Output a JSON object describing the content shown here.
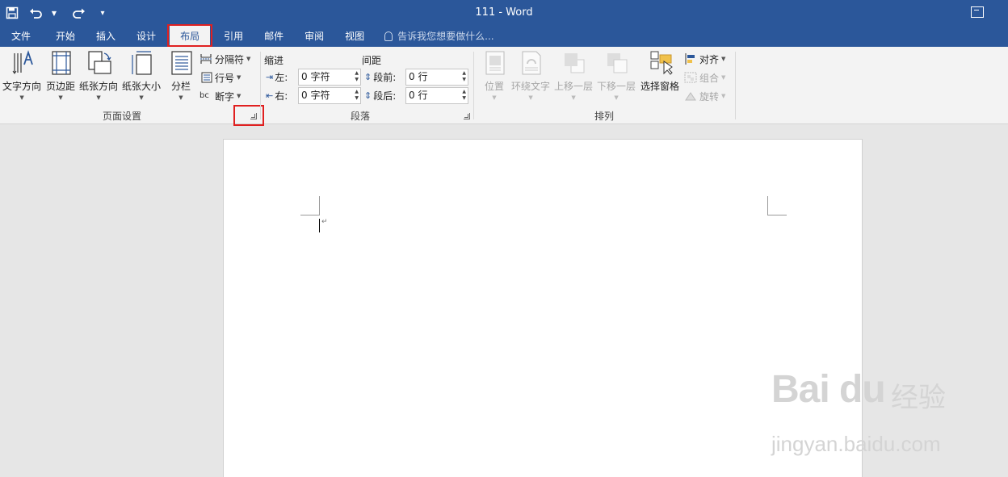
{
  "title_bar": {
    "document_title": "111 - Word"
  },
  "tabs": [
    {
      "label": "文件"
    },
    {
      "label": "开始"
    },
    {
      "label": "插入"
    },
    {
      "label": "设计"
    },
    {
      "label": "布局",
      "active": true
    },
    {
      "label": "引用"
    },
    {
      "label": "邮件"
    },
    {
      "label": "审阅"
    },
    {
      "label": "视图"
    }
  ],
  "tell_me": "告诉我您想要做什么...",
  "page_setup": {
    "group_label": "页面设置",
    "text_direction": "文字方向",
    "margins": "页边距",
    "orientation": "纸张方向",
    "size": "纸张大小",
    "columns": "分栏",
    "breaks": "分隔符",
    "line_numbers": "行号",
    "hyphenation": "断字"
  },
  "paragraph": {
    "group_label": "段落",
    "indent_header": "缩进",
    "spacing_header": "间距",
    "indent_left_label": "左:",
    "indent_left_value": "0 字符",
    "indent_right_label": "右:",
    "indent_right_value": "0 字符",
    "spacing_before_label": "段前:",
    "spacing_before_value": "0 行",
    "spacing_after_label": "段后:",
    "spacing_after_value": "0 行"
  },
  "arrange": {
    "group_label": "排列",
    "position": "位置",
    "wrap_text": "环绕文字",
    "bring_forward": "上移一层",
    "send_backward": "下移一层",
    "selection_pane": "选择窗格",
    "align": "对齐",
    "group": "组合",
    "rotate": "旋转"
  },
  "watermark": {
    "logo": "Bai du",
    "suffix": "经验",
    "url": "jingyan.baidu.com"
  },
  "colors": {
    "accent": "#2b579a",
    "highlight": "#e02020"
  }
}
